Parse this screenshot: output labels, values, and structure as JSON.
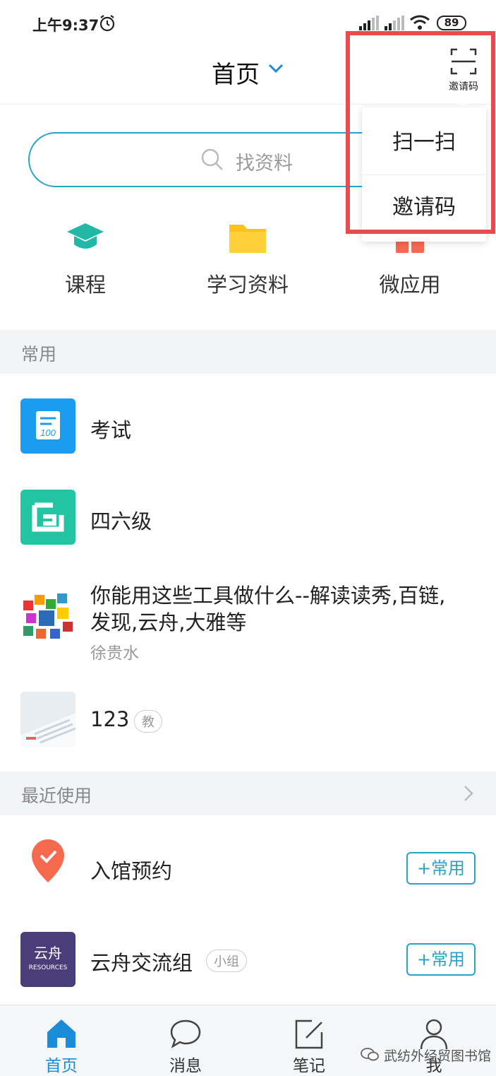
{
  "status_bar": {
    "time": "上午9:37",
    "battery": "89"
  },
  "header": {
    "title": "首页",
    "invite_label": "邀请码"
  },
  "search": {
    "placeholder": "找资料"
  },
  "quick_entries": [
    {
      "label": "课程",
      "icon": "graduation-cap-icon",
      "color": "#22b8a8"
    },
    {
      "label": "学习资料",
      "icon": "folder-icon",
      "color": "#ffc21a"
    },
    {
      "label": "微应用",
      "icon": "apps-icon",
      "color": "#f56a4f"
    }
  ],
  "sections": {
    "common_title": "常用",
    "recent_title": "最近使用"
  },
  "common_items": [
    {
      "title": "考试",
      "icon": "exam-icon",
      "color": "#1a9cf0"
    },
    {
      "title": "四六级",
      "icon": "cet-icon",
      "color": "#22c4a4"
    },
    {
      "title_line1": "你能用这些工具做什么--解读读秀,百链,",
      "title_line2": "发现,云舟,大雅等",
      "subtitle": "徐贵水",
      "icon": "colorful-cubes-thumbnail"
    },
    {
      "title": "123",
      "tag": "教",
      "icon": "keyboard-photo-thumbnail"
    }
  ],
  "recent_items": [
    {
      "title": "入馆预约",
      "icon": "location-check-icon",
      "color": "#f56a4f",
      "action": "+常用"
    },
    {
      "title": "云舟交流组",
      "tag": "小组",
      "icon": "yunzhou-logo",
      "logo_text": "云舟",
      "logo_sub": "RESOURCES",
      "action": "+常用"
    }
  ],
  "menu": {
    "items": [
      "扫一扫",
      "邀请码"
    ],
    "highlight_color": "#e94b4f"
  },
  "tabs": [
    {
      "label": "首页",
      "icon": "home-icon",
      "active": true
    },
    {
      "label": "消息",
      "icon": "chat-bubble-icon",
      "active": false
    },
    {
      "label": "笔记",
      "icon": "note-edit-icon",
      "active": false
    },
    {
      "label": "我",
      "icon": "person-icon",
      "active": false
    }
  ],
  "watermark": "武纺外经贸图书馆",
  "colors": {
    "accent": "#2aa3c9",
    "active_tab": "#1a8cd8"
  }
}
